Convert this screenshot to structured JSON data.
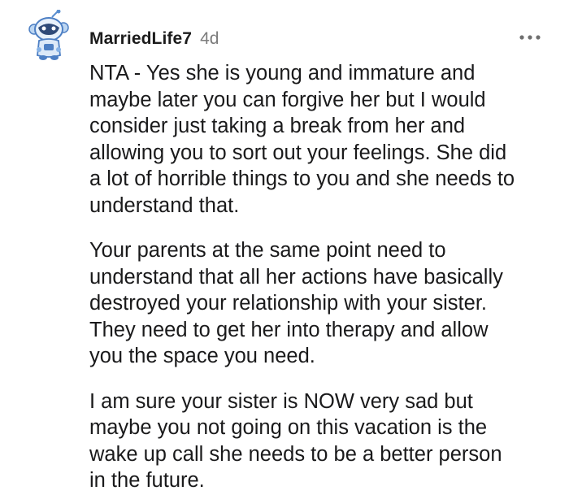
{
  "comment": {
    "username": "MarriedLife7",
    "age": "4d",
    "more_icon": "more-options-icon",
    "avatar_icon": "snoo-avatar-icon",
    "paragraphs": [
      {
        "lines": [
          "NTA - Yes she is young and immature and",
          "maybe later you can forgive her but I would",
          "consider just taking a break from her and",
          "allowing you to sort out your feelings. She did",
          "a lot of horrible things to you and she needs to",
          "understand that."
        ]
      },
      {
        "lines": [
          "Your parents at the same point need to",
          "understand that all her actions have basically",
          "destroyed your relationship with your sister.",
          "They need to get her into therapy and allow",
          "you the space you need."
        ]
      },
      {
        "lines": [
          "I am sure your sister is NOW very sad but",
          "maybe you not going on this vacation is the",
          "wake up call she needs to be a better person",
          "in the future."
        ]
      }
    ]
  }
}
